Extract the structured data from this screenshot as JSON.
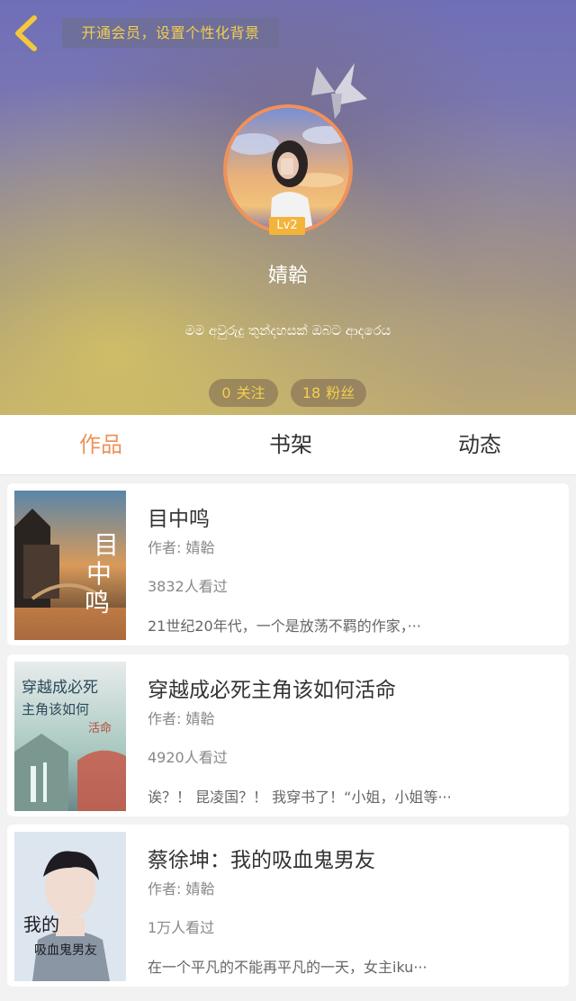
{
  "header": {
    "back_icon": "chevron-left-icon",
    "vip_banner": "开通会员，设置个性化背景",
    "level": "Lv2",
    "username": "婧韐",
    "bio": "මම අවුරුදු තුන්දහසක් ඔබට ආදරෙය",
    "stats": {
      "follow_count": "0",
      "follow_label": "关注",
      "fans_count": "18",
      "fans_label": "粉丝"
    },
    "colors": {
      "accent": "#f0915a",
      "gold": "#f3cf4f"
    }
  },
  "tabs": [
    {
      "label": "作品",
      "active": true
    },
    {
      "label": "书架",
      "active": false
    },
    {
      "label": "动态",
      "active": false
    }
  ],
  "books": [
    {
      "title": "目中鸣",
      "author": "作者: 婧韐",
      "views": "3832人看过",
      "desc": "21世纪20年代，一个是放荡不羁的作家，···",
      "cover_text": "目中鸣"
    },
    {
      "title": "穿越成必死主角该如何活命",
      "author": "作者: 婧韐",
      "views": "4920人看过",
      "desc": "诶？！ 昆凌国？！ 我穿书了！“小姐，小姐等···",
      "cover_text": "穿越成必死主角该如何活命"
    },
    {
      "title": "蔡徐坤：我的吸血鬼男友",
      "author": "作者: 婧韐",
      "views": "1万人看过",
      "desc": "在一个平凡的不能再平凡的一天，女主iku···",
      "cover_text": "我的吸血鬼男友"
    }
  ]
}
